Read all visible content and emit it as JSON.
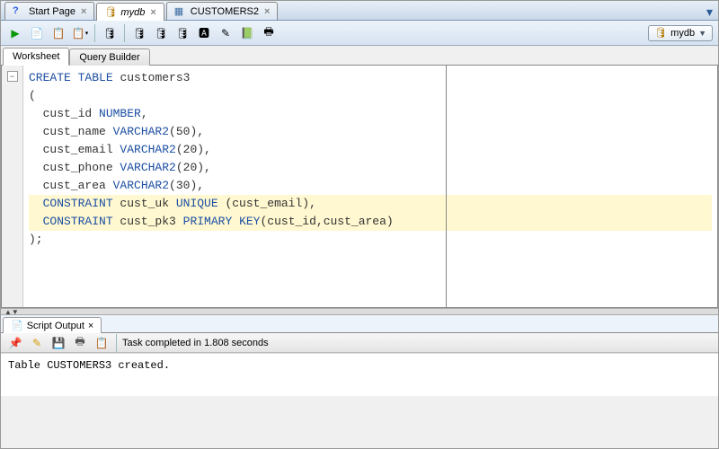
{
  "tabs": [
    {
      "label": "Start Page",
      "icon": "?"
    },
    {
      "label": "mydb",
      "icon": "db",
      "active": true
    },
    {
      "label": "CUSTOMERS2",
      "icon": "grid"
    }
  ],
  "toolbar_icons": {
    "run": "▶",
    "script": "📄",
    "explain": "📋",
    "autotrace": "🗂",
    "commit": "🛢",
    "rollback": "🛢",
    "clear": "🛢",
    "find": "🔍",
    "undo": "🅰",
    "format": "✎",
    "opt1": "📗",
    "opt2": "🖶"
  },
  "connection": {
    "icon": "🛢",
    "name": "mydb"
  },
  "subtabs": [
    {
      "label": "Worksheet",
      "active": true
    },
    {
      "label": "Query Builder",
      "active": false
    }
  ],
  "sql": {
    "l1a": "CREATE",
    "l1b": "TABLE",
    "l1c": " customers3",
    "l2": "(",
    "l3a": "  cust_id ",
    "l3b": "NUMBER",
    "l3c": ",",
    "l4a": "  cust_name ",
    "l4b": "VARCHAR2",
    "l4c": "(50),",
    "l5a": "  cust_email ",
    "l5b": "VARCHAR2",
    "l5c": "(20),",
    "l6a": "  cust_phone ",
    "l6b": "VARCHAR2",
    "l6c": "(20),",
    "l7a": "  cust_area ",
    "l7b": "VARCHAR2",
    "l7c": "(30),",
    "l8a": "  CONSTRAINT",
    "l8b": " cust_uk ",
    "l8c": "UNIQUE",
    "l8d": " (cust_email),",
    "l9a": "  CONSTRAINT",
    "l9b": " cust_pk3",
    "l9c": " PRIMARY",
    "l9d": " KEY",
    "l9e": "(cust_id,cust_area)",
    "l10": ");"
  },
  "output": {
    "tab_label": "Script Output",
    "status": "Task completed in 1.808 seconds",
    "body": "Table CUSTOMERS3 created.",
    "icons": {
      "pin": "📌",
      "clear": "✎",
      "save": "💾",
      "print": "🖶",
      "list": "📋"
    }
  }
}
